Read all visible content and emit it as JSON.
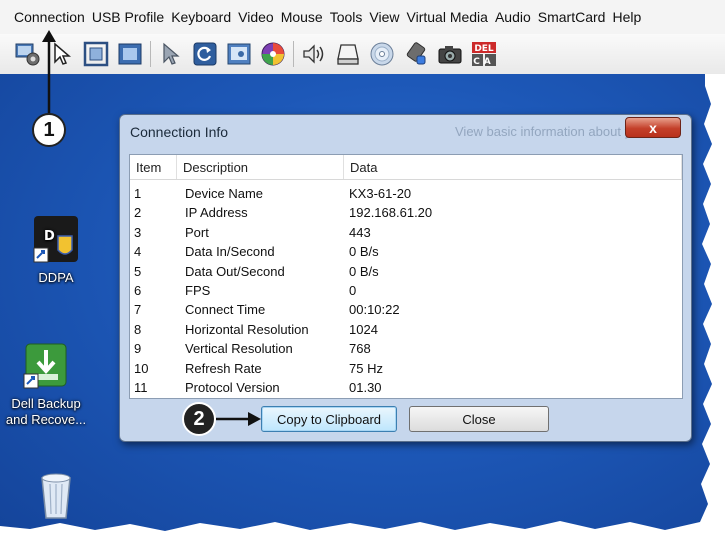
{
  "menubar": {
    "items": [
      "Connection",
      "USB Profile",
      "Keyboard",
      "Video",
      "Mouse",
      "Tools",
      "View",
      "Virtual Media",
      "Audio",
      "SmartCard",
      "Help"
    ]
  },
  "toolbar": {
    "icons": [
      "connection-settings-icon",
      "pointer-icon",
      "fit-window-icon",
      "fullscreen-icon",
      "single-cursor-icon",
      "refresh-icon",
      "screen-capture-icon",
      "color-icon",
      "speaker-icon",
      "drive-icon",
      "cd-icon",
      "usb-icon",
      "camera-icon",
      "ctrl-alt-del-icon"
    ],
    "cad_label_top": "DEL",
    "cad_label_bottom": "CA"
  },
  "desktop": {
    "icons": [
      {
        "label_line1": "DDPA",
        "label_line2": ""
      },
      {
        "label_line1": "Dell Backup",
        "label_line2": "and Recove..."
      },
      {
        "label_line1": "",
        "label_line2": ""
      }
    ]
  },
  "callouts": {
    "first": "1",
    "second": "2"
  },
  "dialog": {
    "title": "Connection Info",
    "background_text": "View basic information about yo",
    "close_glyph": "x",
    "columns": [
      "Item",
      "Description",
      "Data"
    ],
    "rows": [
      {
        "item": "1",
        "description": "Device Name",
        "data": "KX3-61-20"
      },
      {
        "item": "2",
        "description": "IP Address",
        "data": "192.168.61.20"
      },
      {
        "item": "3",
        "description": "Port",
        "data": "443"
      },
      {
        "item": "4",
        "description": "Data In/Second",
        "data": "0 B/s"
      },
      {
        "item": "5",
        "description": "Data Out/Second",
        "data": "0 B/s"
      },
      {
        "item": "6",
        "description": "FPS",
        "data": "0"
      },
      {
        "item": "7",
        "description": "Connect Time",
        "data": "00:10:22"
      },
      {
        "item": "8",
        "description": "Horizontal Resolution",
        "data": "1024"
      },
      {
        "item": "9",
        "description": "Vertical Resolution",
        "data": "768"
      },
      {
        "item": "10",
        "description": "Refresh Rate",
        "data": "75 Hz"
      },
      {
        "item": "11",
        "description": "Protocol Version",
        "data": "01.30"
      }
    ],
    "copy_button": "Copy to Clipboard",
    "close_button": "Close"
  },
  "colors": {
    "desktop_blue": "#1d58b8",
    "dialog_frame": "#c6d6ec",
    "close_red": "#c4402a"
  }
}
